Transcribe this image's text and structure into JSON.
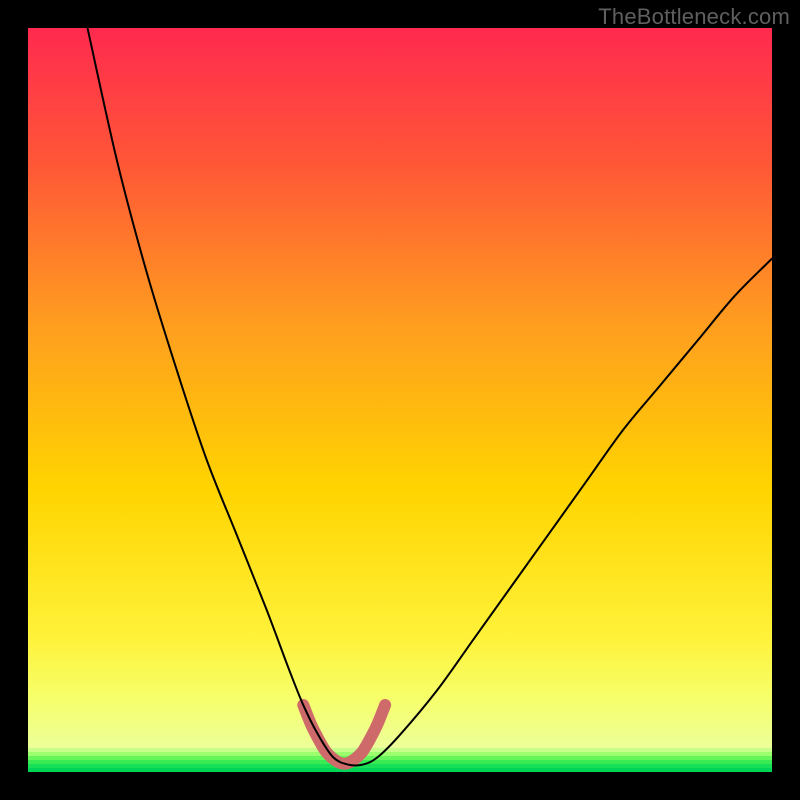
{
  "watermark": "TheBottleneck.com",
  "chart_data": {
    "type": "line",
    "title": "",
    "xlabel": "",
    "ylabel": "",
    "xlim": [
      0,
      100
    ],
    "ylim": [
      0,
      100
    ],
    "grid": false,
    "background_gradient": {
      "top": "#ff2a4f",
      "mid": "#ffe100",
      "bottom": "#00e65a"
    },
    "series": [
      {
        "name": "bottleneck-curve",
        "color": "#000000",
        "x": [
          8,
          12,
          16,
          20,
          24,
          28,
          32,
          35,
          37,
          39,
          41,
          43,
          45,
          47,
          50,
          55,
          60,
          65,
          70,
          75,
          80,
          85,
          90,
          95,
          100
        ],
        "y": [
          100,
          82,
          67,
          54,
          42,
          32,
          22,
          14,
          9,
          5,
          2,
          1,
          1,
          2,
          5,
          11,
          18,
          25,
          32,
          39,
          46,
          52,
          58,
          64,
          69
        ]
      },
      {
        "name": "optimal-range-highlight",
        "color": "#cf6a6a",
        "x": [
          37,
          38,
          39,
          40,
          41,
          42,
          43,
          44,
          45,
          46,
          47,
          48
        ],
        "y": [
          9,
          6.5,
          4.5,
          2.8,
          1.8,
          1.2,
          1.2,
          1.8,
          2.8,
          4.5,
          6.5,
          9
        ]
      }
    ],
    "annotations": []
  }
}
